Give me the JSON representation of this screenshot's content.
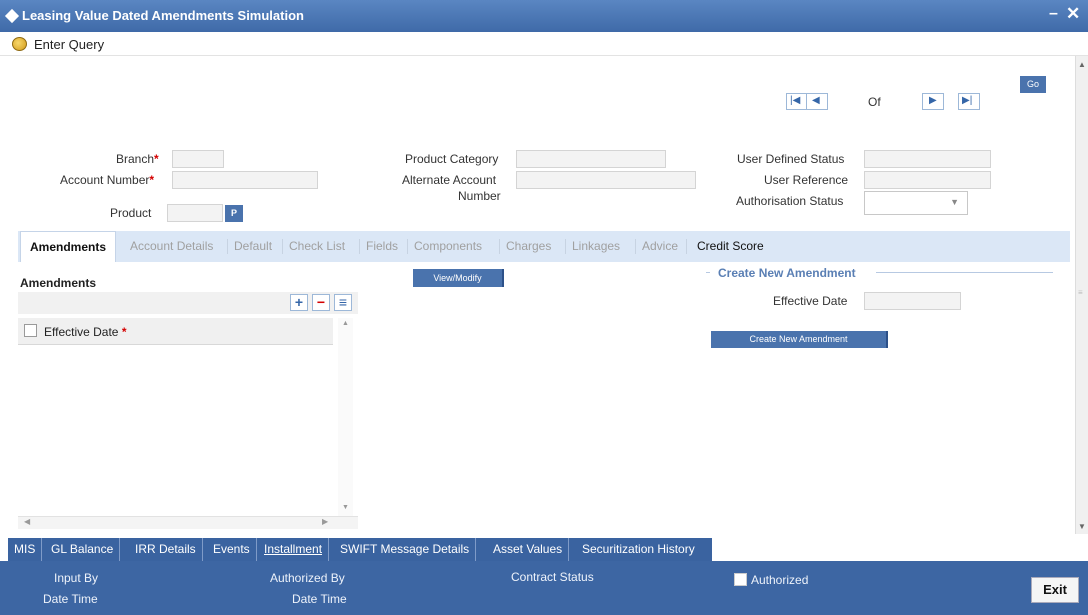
{
  "window": {
    "title": "Leasing Value Dated Amendments Simulation",
    "minimize_glyph": "–",
    "close_glyph": "✕"
  },
  "toolbar": {
    "enter_query": "Enter Query"
  },
  "nav": {
    "of_label": "Of",
    "go_label": "Go"
  },
  "header": {
    "branch_label": "Branch",
    "account_number_label": "Account Number",
    "product_label": "Product",
    "product_lov": "P",
    "product_category_label": "Product Category",
    "alternate_account_label_line1": "Alternate Account",
    "alternate_account_label_line2": "Number",
    "user_defined_status_label": "User Defined Status",
    "user_reference_label": "User Reference",
    "authorisation_status_label": "Authorisation Status",
    "required_mark": "*"
  },
  "tabs": [
    "Amendments",
    "Account Details",
    "Default",
    "Check List",
    "Fields",
    "Components",
    "Charges",
    "Linkages",
    "Advice",
    "Credit Score"
  ],
  "amendments": {
    "section_title": "Amendments",
    "add_glyph": "+",
    "remove_glyph": "−",
    "list_glyph": "≡",
    "column_effective_date": "Effective Date",
    "view_modify_label": "View/Modify",
    "create_section_title": "Create New Amendment",
    "effective_date_label": "Effective Date",
    "create_button_label": "Create New Amendment"
  },
  "subtabs": [
    "MIS",
    "GL Balance",
    "IRR Details",
    "Events",
    "Installment",
    "SWIFT Message Details",
    "Asset Values",
    "Securitization History"
  ],
  "footer": {
    "input_by": "Input By",
    "date_time_1": "Date Time",
    "authorized_by": "Authorized By",
    "date_time_2": "Date Time",
    "contract_status": "Contract Status",
    "authorized": "Authorized",
    "exit_label": "Exit"
  }
}
